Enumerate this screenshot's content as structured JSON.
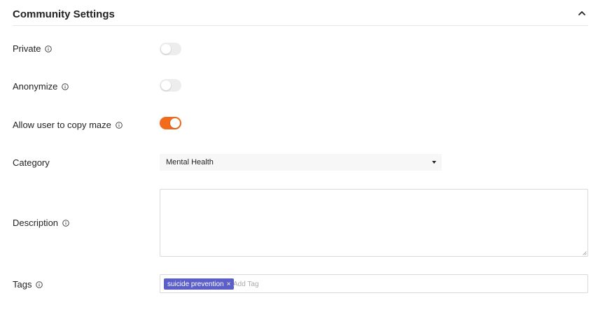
{
  "section": {
    "title": "Community Settings"
  },
  "fields": {
    "private": {
      "label": "Private",
      "enabled": false
    },
    "anonymize": {
      "label": "Anonymize",
      "enabled": false
    },
    "allow_copy": {
      "label": "Allow user to copy maze",
      "enabled": true
    },
    "category": {
      "label": "Category",
      "selected": "Mental Health"
    },
    "description": {
      "label": "Description",
      "value": ""
    },
    "tags": {
      "label": "Tags",
      "items": [
        "suicide prevention"
      ],
      "remove_glyph": "×",
      "placeholder": "Add Tag"
    }
  },
  "colors": {
    "accent": "#f26a1b",
    "tag": "#5b5fc7",
    "toggle_off": "#ededed"
  },
  "icons": {
    "info": "info-circle-icon",
    "collapse": "chevron-up-icon",
    "dropdown": "caret-down-icon",
    "tag_remove": "close-icon"
  }
}
